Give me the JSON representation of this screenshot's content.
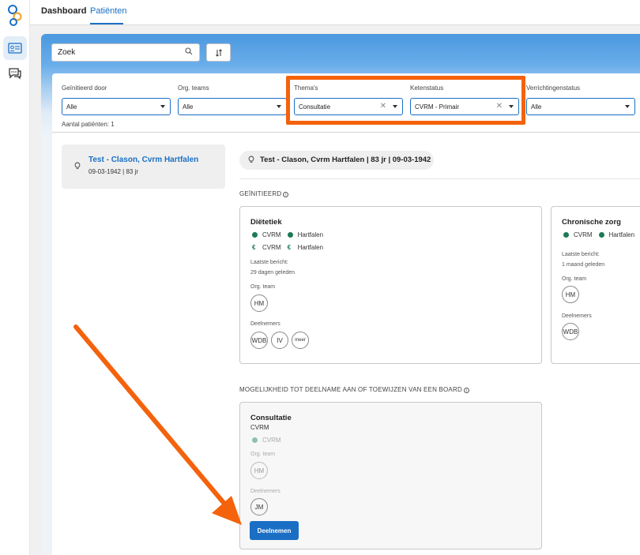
{
  "nav": {
    "tabs": [
      {
        "label": "Dashboard"
      },
      {
        "label": "Patiënten"
      }
    ]
  },
  "search": {
    "placeholder": "Zoek",
    "value": "Zoek"
  },
  "filters": [
    {
      "label": "Geïnitieerd door",
      "value": "Alle"
    },
    {
      "label": "Org. teams",
      "value": "Alle"
    },
    {
      "label": "Thema's",
      "value": "Consultatie"
    },
    {
      "label": "Ketenstatus",
      "value": "CVRM - Primair"
    },
    {
      "label": "Verrichtingenstatus",
      "value": "Alle"
    }
  ],
  "patient_count": "Aantal patiënten: 1",
  "patient": {
    "name": "Test - Clason, Cvrm Hartfalen",
    "meta": "09-03-1942 | 83 jr",
    "summary": "Test - Clason, Cvrm Hartfalen | 83 jr | 09-03-1942"
  },
  "initiated": {
    "title": "GEÏNITIEERD",
    "cards": [
      {
        "title": "Diëtetiek",
        "rows": [
          [
            "CVRM",
            "Hartfalen"
          ],
          [
            "CVRM",
            "Hartfalen"
          ]
        ],
        "last_label": "Laatste bericht:",
        "last_value": "29 dagen geleden",
        "team_label": "Org. team",
        "team": [
          "HM"
        ],
        "members_label": "Deelnemers",
        "members": [
          "WDB",
          "IV",
          "meer"
        ]
      },
      {
        "title": "Chronische zorg",
        "rows": [
          [
            "CVRM",
            "Hartfalen"
          ]
        ],
        "last_label": "Laatste bericht:",
        "last_value": "1 maand geleden",
        "team_label": "Org. team",
        "team": [
          "HM"
        ],
        "members_label": "Deelnemers",
        "members": [
          "WDB"
        ]
      }
    ]
  },
  "possible": {
    "title": "MOGELIJKHEID TOT DEELNAME AAN OF TOEWIJZEN VAN EEN BOARD",
    "card": {
      "title": "Consultatie",
      "subtitle": "CVRM",
      "row": "CVRM",
      "team_label": "Org. team",
      "team": [
        "HM"
      ],
      "members_label": "Deelnemers",
      "members": [
        "JM"
      ],
      "button": "Deelnemen"
    }
  },
  "colors": {
    "accent": "#1a6fc4",
    "highlight": "#f4620c",
    "status_green": "#1d7a55"
  }
}
